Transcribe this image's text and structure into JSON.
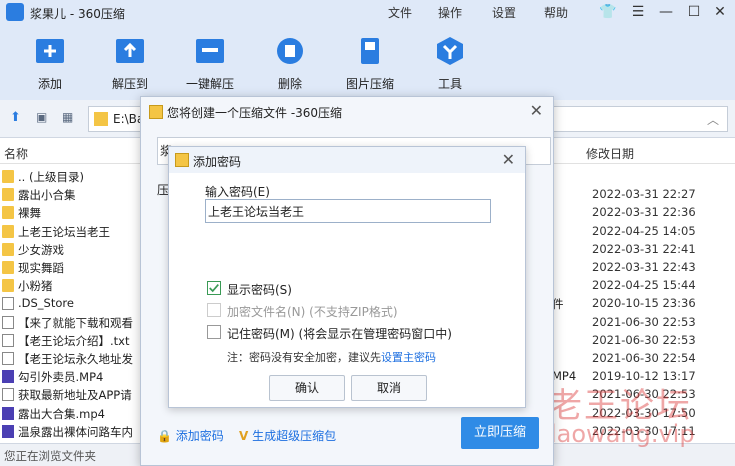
{
  "app": {
    "title": "浆果儿 - 360压缩",
    "menus": [
      "文件",
      "操作",
      "设置",
      "帮助"
    ]
  },
  "toolbar": {
    "items": [
      {
        "label": "添加",
        "icon": "add-icon"
      },
      {
        "label": "解压到",
        "icon": "extract-icon"
      },
      {
        "label": "一键解压",
        "icon": "quick-extract-icon"
      },
      {
        "label": "删除",
        "icon": "trash-icon"
      },
      {
        "label": "图片压缩",
        "icon": "image-compress-icon"
      },
      {
        "label": "工具",
        "icon": "tools-icon"
      }
    ]
  },
  "address": {
    "path": "E:\\Ba"
  },
  "list": {
    "col_name": "名称",
    "col_date": "修改日期",
    "rows": [
      {
        "name": ".. (上级目录)",
        "type": "folder",
        "extra": "",
        "date": ""
      },
      {
        "name": "露出小合集",
        "type": "folder",
        "extra": "",
        "date": "2022-03-31 22:27"
      },
      {
        "name": "裸舞",
        "type": "folder",
        "extra": "",
        "date": "2022-03-31 22:36"
      },
      {
        "name": "上老王论坛当老王",
        "type": "folder",
        "extra": "",
        "date": "2022-04-25 14:05"
      },
      {
        "name": "少女游戏",
        "type": "folder",
        "extra": "",
        "date": "2022-03-31 22:41"
      },
      {
        "name": "现实舞蹈",
        "type": "folder",
        "extra": "",
        "date": "2022-03-31 22:43"
      },
      {
        "name": "小粉猪",
        "type": "folder",
        "extra": "",
        "date": "2022-04-25 15:44"
      },
      {
        "name": ".DS_Store",
        "type": "doc",
        "extra": "件",
        "date": "2020-10-15 23:36"
      },
      {
        "name": "【来了就能下载和观看",
        "type": "doc",
        "extra": "",
        "date": "2021-06-30 22:53"
      },
      {
        "name": "【老王论坛介绍】.txt",
        "type": "doc",
        "extra": "",
        "date": "2021-06-30 22:53"
      },
      {
        "name": "【老王论坛永久地址发",
        "type": "doc",
        "extra": "",
        "date": "2021-06-30 22:54"
      },
      {
        "name": "勾引外卖员.MP4",
        "type": "mp4",
        "extra": "MP4",
        "date": "2019-10-12 13:17"
      },
      {
        "name": "获取最新地址及APP请",
        "type": "doc",
        "extra": "",
        "date": "2021-06-30 22:53"
      },
      {
        "name": "露出大合集.mp4",
        "type": "mp4",
        "extra": "",
        "date": "2022-03-30 17:50"
      },
      {
        "name": "温泉露出裸体问路车内",
        "type": "mp4",
        "extra": "",
        "date": "2022-03-30 17:11"
      }
    ]
  },
  "status": {
    "text": "您正在浏览文件夹"
  },
  "watermark": {
    "line1": "老王论坛",
    "line2": "laowang.vip"
  },
  "outer_dialog": {
    "title": "您将创建一个压缩文件 -360压缩",
    "fragment_top": "浆",
    "fragment_side": "压",
    "add_password_link": "添加密码",
    "super_compress_link": "生成超级压缩包",
    "compress_button": "立即压缩"
  },
  "inner_dialog": {
    "title": "添加密码",
    "password_label": "输入密码(E)",
    "password_value": "上老王论坛当老王",
    "show_password": {
      "label": "显示密码(S)",
      "checked": true
    },
    "encrypt_names": {
      "label": "加密文件名(N) (不支持ZIP格式)",
      "checked": false
    },
    "remember": {
      "label": "记住密码(M) (将会显示在管理密码窗口中)",
      "checked": false
    },
    "note_prefix": "注：密码没有安全加密，建议先",
    "note_link": "设置主密码",
    "ok_button": "确认",
    "cancel_button": "取消"
  }
}
